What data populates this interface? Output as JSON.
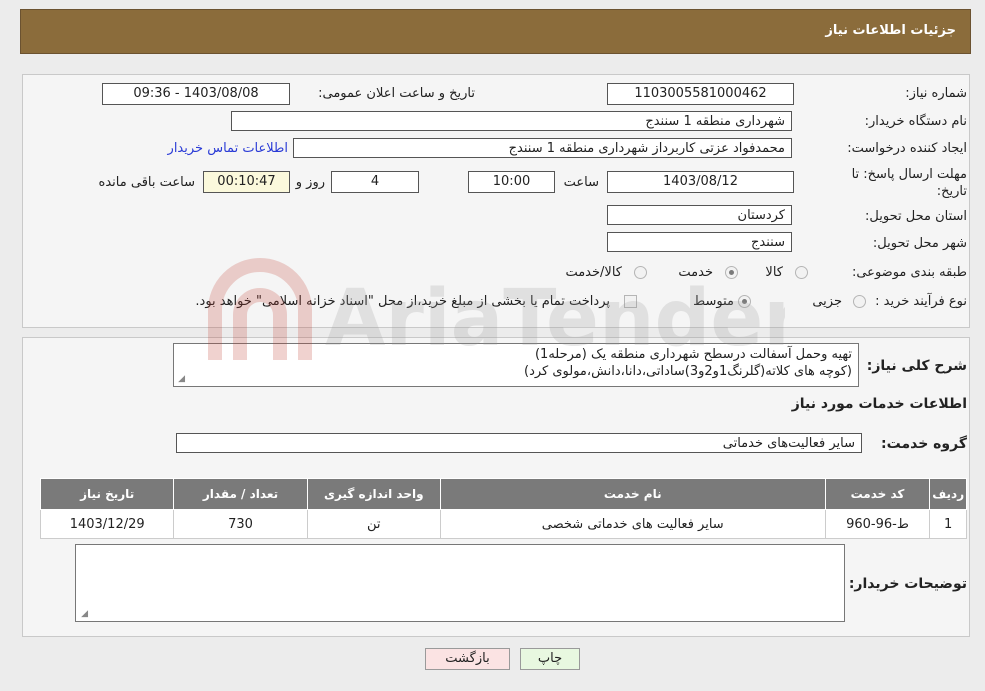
{
  "header": {
    "title": "جزئیات اطلاعات نیاز"
  },
  "fields": {
    "need_number_label": "شماره نیاز:",
    "need_number": "1103005581000462",
    "announce_label": "تاریخ و ساعت اعلان عمومی:",
    "announce_value": "1403/08/08 - 09:36",
    "buyer_org_label": "نام دستگاه خریدار:",
    "buyer_org": "شهرداری منطقه 1 سنندج",
    "creator_label": "ایجاد کننده درخواست:",
    "creator": "محمدفواد عزتی کاربرداز شهرداری منطقه 1 سنندج",
    "contact_link": "اطلاعات تماس خریدار",
    "deadline_label_1": "مهلت ارسال پاسخ: تا",
    "deadline_label_2": "تاریخ:",
    "deadline_date": "1403/08/12",
    "time_label": "ساعت",
    "deadline_time": "10:00",
    "days_value": "4",
    "days_label": "روز و",
    "remaining_time": "00:10:47",
    "remaining_label": "ساعت باقی مانده",
    "province_label": "استان محل تحویل:",
    "province": "کردستان",
    "city_label": "شهر محل تحویل:",
    "city": "سنندج",
    "category_label": "طبقه بندی موضوعی:",
    "category_options": [
      "کالا",
      "خدمت",
      "کالا/خدمت"
    ],
    "category_selected": "خدمت",
    "process_label": "نوع فرآیند خرید :",
    "process_options": [
      "جزیی",
      "متوسط"
    ],
    "process_selected": "متوسط",
    "payment_note": "پرداخت تمام یا بخشی از مبلغ خرید،از محل \"اسناد خزانه اسلامی\" خواهد بود."
  },
  "description": {
    "label": "شرح کلی نیاز:",
    "line1": "تهیه وحمل آسفالت درسطح شهرداری منطقه یک (مرحله1)",
    "line2": "(کوچه های کلاته(گلرنگ1و2و3)ساداتی،دانا،دانش،مولوی کرد)"
  },
  "services": {
    "title": "اطلاعات خدمات مورد نیاز",
    "group_label": "گروه خدمت:",
    "group_value": "سایر فعالیت‌های خدماتی",
    "columns": [
      "ردیف",
      "کد خدمت",
      "نام خدمت",
      "واحد اندازه گیری",
      "تعداد / مقدار",
      "تاریخ نیاز"
    ],
    "rows": [
      [
        "1",
        "ط-96-960",
        "سایر فعالیت های خدماتی شخصی",
        "تن",
        "730",
        "1403/12/29"
      ]
    ]
  },
  "buyer_notes": {
    "label": "توضیحات خریدار:",
    "value": ""
  },
  "buttons": {
    "print": "چاپ",
    "back": "بازگشت"
  },
  "watermark_text": "AriaTender.neT",
  "colors": {
    "header": "#8b6c3b",
    "table_header": "#7a7a7a",
    "link": "#2a3bd6",
    "back_button": "#fbe3e3",
    "print_button": "#e8f8e0"
  }
}
